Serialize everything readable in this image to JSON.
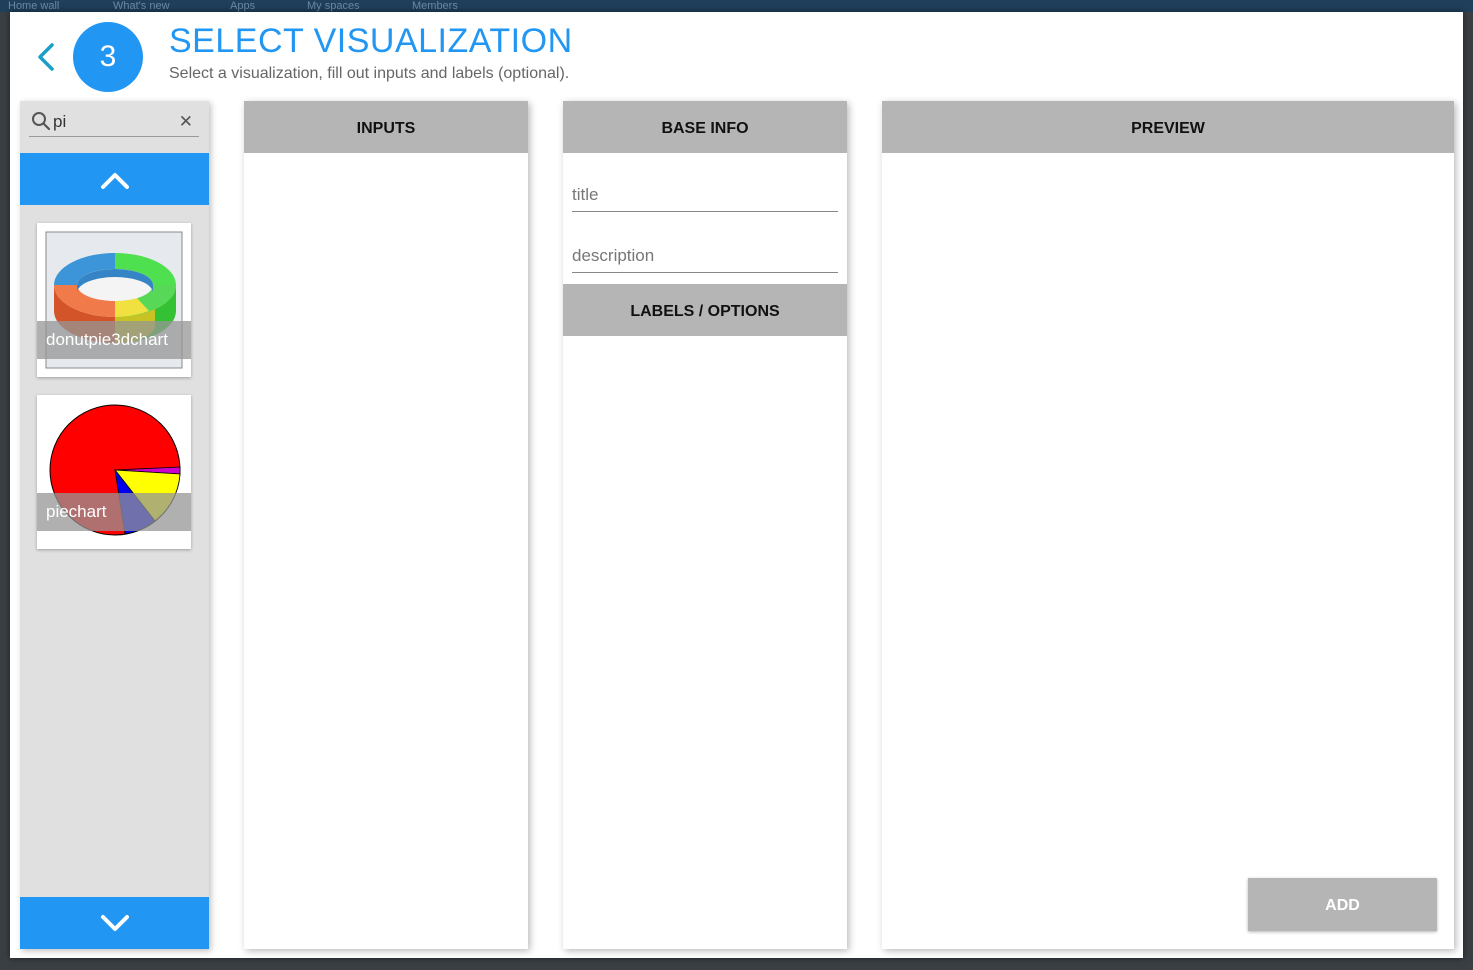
{
  "background_nav": [
    "Home wall",
    "What's new",
    "Apps",
    "My spaces",
    "Members"
  ],
  "header": {
    "step_number": "3",
    "title": "SELECT VISUALIZATION",
    "subtitle": "Select a visualization, fill out inputs and labels (optional)."
  },
  "sidebar": {
    "search": {
      "value": "pi",
      "icon": "search-icon",
      "clear_icon": "close-icon"
    },
    "up_icon": "chevron-up-icon",
    "down_icon": "chevron-down-icon",
    "items": [
      {
        "label": "donutpie3dchart",
        "thumbnail": "donut-3d-chart"
      },
      {
        "label": "piechart",
        "thumbnail": "pie-chart"
      }
    ]
  },
  "panels": {
    "inputs": {
      "title": "INPUTS"
    },
    "base_info": {
      "title": "BASE INFO",
      "title_placeholder": "title",
      "description_placeholder": "description"
    },
    "labels_options": {
      "title": "LABELS / OPTIONS"
    },
    "preview": {
      "title": "PREVIEW",
      "add_label": "ADD"
    }
  },
  "colors": {
    "accent": "#2196f3",
    "panel_header": "#b5b5b5",
    "sidebar_bg": "#e0e0e0"
  }
}
